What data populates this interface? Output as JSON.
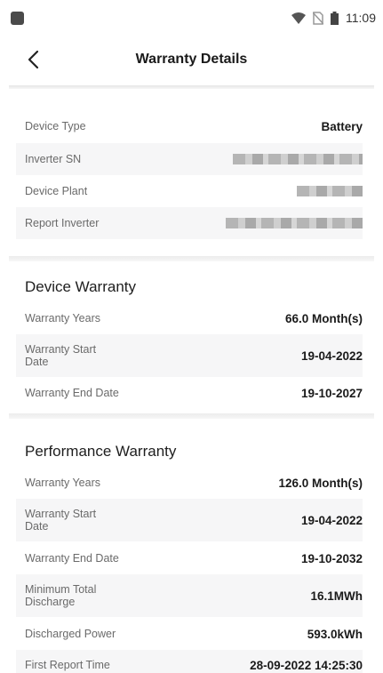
{
  "status_bar": {
    "time": "11:09"
  },
  "header": {
    "title": "Warranty Details"
  },
  "device_info": {
    "rows": [
      {
        "label": "Device Type",
        "value": "Battery"
      },
      {
        "label": "Inverter SN",
        "value": ""
      },
      {
        "label": "Device Plant",
        "value": ""
      },
      {
        "label": "Report Inverter",
        "value": ""
      }
    ]
  },
  "device_warranty": {
    "title": "Device Warranty",
    "rows": [
      {
        "label": "Warranty Years",
        "value": "66.0 Month(s)"
      },
      {
        "label": "Warranty Start Date",
        "value": "19-04-2022"
      },
      {
        "label": "Warranty End Date",
        "value": "19-10-2027"
      }
    ]
  },
  "performance_warranty": {
    "title": "Performance Warranty",
    "rows": [
      {
        "label": "Warranty Years",
        "value": "126.0 Month(s)"
      },
      {
        "label": "Warranty Start Date",
        "value": "19-04-2022"
      },
      {
        "label": "Warranty End Date",
        "value": "19-10-2032"
      },
      {
        "label": "Minimum Total Discharge",
        "value": "16.1MWh"
      },
      {
        "label": "Discharged Power",
        "value": "593.0kWh"
      },
      {
        "label": "First Report Time",
        "value": "28-09-2022 14:25:30"
      }
    ]
  }
}
